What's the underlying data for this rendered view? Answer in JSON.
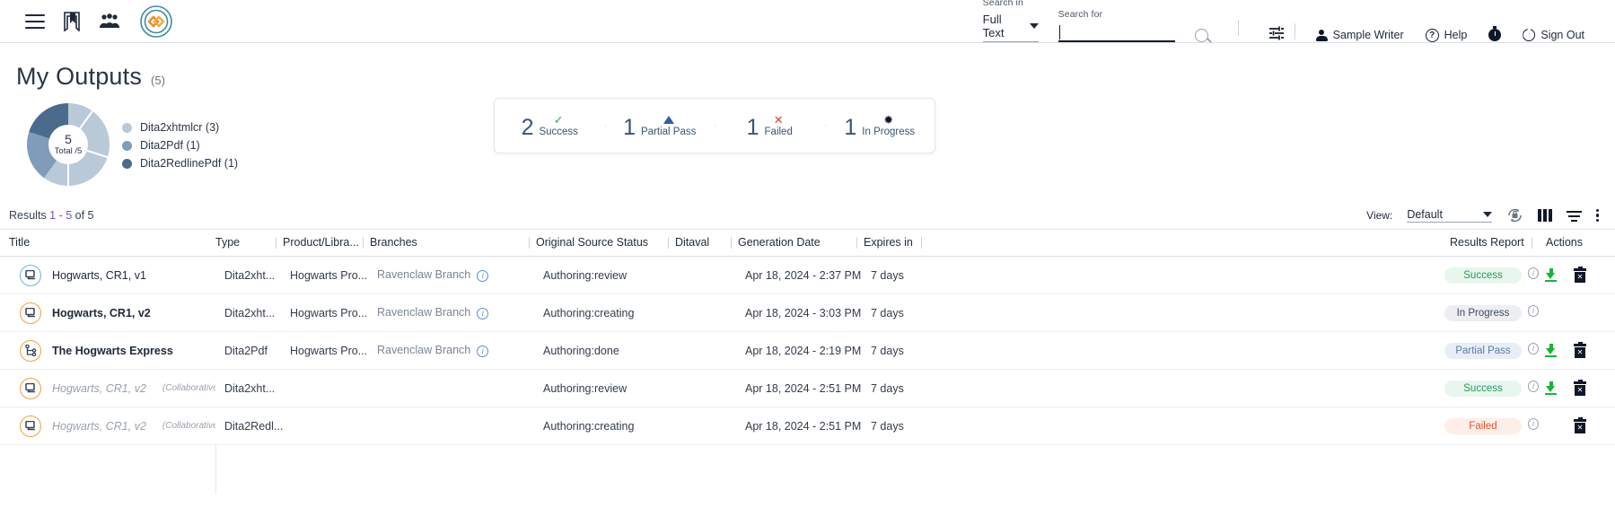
{
  "topbar": {
    "icons": [
      "menu-icon",
      "bookmark-icon",
      "people-icon",
      "brand-logo"
    ],
    "search_in_label": "Search in",
    "search_in_value": "Full Text",
    "search_for_label": "Search for",
    "search_for_value": "",
    "search_for_placeholder": "",
    "user_name": "Sample Writer",
    "help_label": "Help",
    "sign_out_label": "Sign Out"
  },
  "page": {
    "title": "My Outputs",
    "count": "(5)"
  },
  "donut": {
    "center_value": "5",
    "center_label": "Total /5",
    "legend": [
      {
        "label": "Dita2xhtmlcr (3)",
        "color": "#b9c9d7",
        "value": 3
      },
      {
        "label": "Dita2Pdf (1)",
        "color": "#7f9db8",
        "value": 1
      },
      {
        "label": "Dita2RedlinePdf (1)",
        "color": "#4b6b8c",
        "value": 1
      }
    ]
  },
  "stats": [
    {
      "count": "2",
      "label": "Success",
      "icon": "check-icon",
      "glyph": "✓",
      "color": "#2eab57"
    },
    {
      "count": "1",
      "label": "Partial Pass",
      "icon": "triangle-up-icon",
      "glyph": "",
      "color": "#2f5fa8"
    },
    {
      "count": "1",
      "label": "Failed",
      "icon": "cross-icon",
      "glyph": "✕",
      "color": "#e0422c"
    },
    {
      "count": "1",
      "label": "In Progress",
      "icon": "spinner-icon",
      "glyph": "✹",
      "color": "#101828"
    }
  ],
  "results_bar": {
    "prefix": "Results ",
    "range": "1 - 5",
    "suffix": " of 5",
    "view_label": "View:",
    "view_value": "Default",
    "icons": [
      "refresh-lock-icon",
      "columns-icon",
      "filter-icon",
      "kebab-menu-icon"
    ]
  },
  "table": {
    "columns": [
      "Title",
      "Type",
      "Product/Libra...",
      "Branches",
      "Original Source Status",
      "Ditaval",
      "Generation Date",
      "Expires in",
      "",
      "Results Report",
      "Actions"
    ],
    "rows": [
      {
        "icon": "topic-map-icon",
        "icon_color": "blue",
        "title": "Hogwarts, CR1, v1",
        "title_style": "normal",
        "title_sub": "",
        "type": "Dita2xht...",
        "product": "Hogwarts Pro...",
        "branch": "Ravenclaw Branch",
        "branch_info": "info-icon",
        "source_status": "Authoring:review",
        "ditaval": "",
        "generation_date": "Apr 18, 2024 - 2:37 PM",
        "expires_in": "7 days",
        "report": "Success",
        "report_kind": "success",
        "actions": [
          "download-icon",
          "delete-icon"
        ]
      },
      {
        "icon": "topic-map-icon",
        "icon_color": "orange",
        "title": "Hogwarts, CR1, v2",
        "title_style": "bold",
        "title_sub": "",
        "type": "Dita2xht...",
        "product": "Hogwarts Pro...",
        "branch": "Ravenclaw Branch",
        "branch_info": "info-icon",
        "source_status": "Authoring:creating",
        "ditaval": "",
        "generation_date": "Apr 18, 2024 - 3:03 PM",
        "expires_in": "7 days",
        "report": "In Progress",
        "report_kind": "inprogress",
        "actions": []
      },
      {
        "icon": "hierarchy-icon",
        "icon_color": "orange",
        "title": "The Hogwarts Express",
        "title_style": "bold",
        "title_sub": "",
        "type": "Dita2Pdf",
        "product": "Hogwarts Pro...",
        "branch": "Ravenclaw Branch",
        "branch_info": "info-icon",
        "source_status": "Authoring:done",
        "ditaval": "",
        "generation_date": "Apr 18, 2024 - 2:19 PM",
        "expires_in": "7 days",
        "report": "Partial Pass",
        "report_kind": "partial",
        "actions": [
          "download-icon",
          "delete-icon"
        ]
      },
      {
        "icon": "topic-map-icon",
        "icon_color": "orange",
        "title": "Hogwarts, CR1, v2",
        "title_style": "dim",
        "title_sub": "(Collaborative R",
        "type": "Dita2xht...",
        "product": "",
        "branch": "",
        "branch_info": "",
        "source_status": "Authoring:review",
        "ditaval": "",
        "generation_date": "Apr 18, 2024 - 2:51 PM",
        "expires_in": "7 days",
        "report": "Success",
        "report_kind": "success",
        "actions": [
          "download-icon",
          "delete-icon"
        ]
      },
      {
        "icon": "topic-map-icon",
        "icon_color": "orange",
        "title": "Hogwarts, CR1, v2",
        "title_style": "dim",
        "title_sub": "(Collaborative R",
        "type": "Dita2Redl...",
        "product": "",
        "branch": "",
        "branch_info": "",
        "source_status": "Authoring:creating",
        "ditaval": "",
        "generation_date": "Apr 18, 2024 - 2:51 PM",
        "expires_in": "7 days",
        "report": "Failed",
        "report_kind": "failed",
        "actions": [
          "delete-icon"
        ]
      }
    ]
  },
  "colors": {
    "accent_orange": "#f2a03d",
    "accent_blue": "#6cb4e4",
    "success": "#1f9d55",
    "failed": "#e2542c",
    "partial": "#5b7ca8",
    "stat_number": "#3b5378"
  }
}
